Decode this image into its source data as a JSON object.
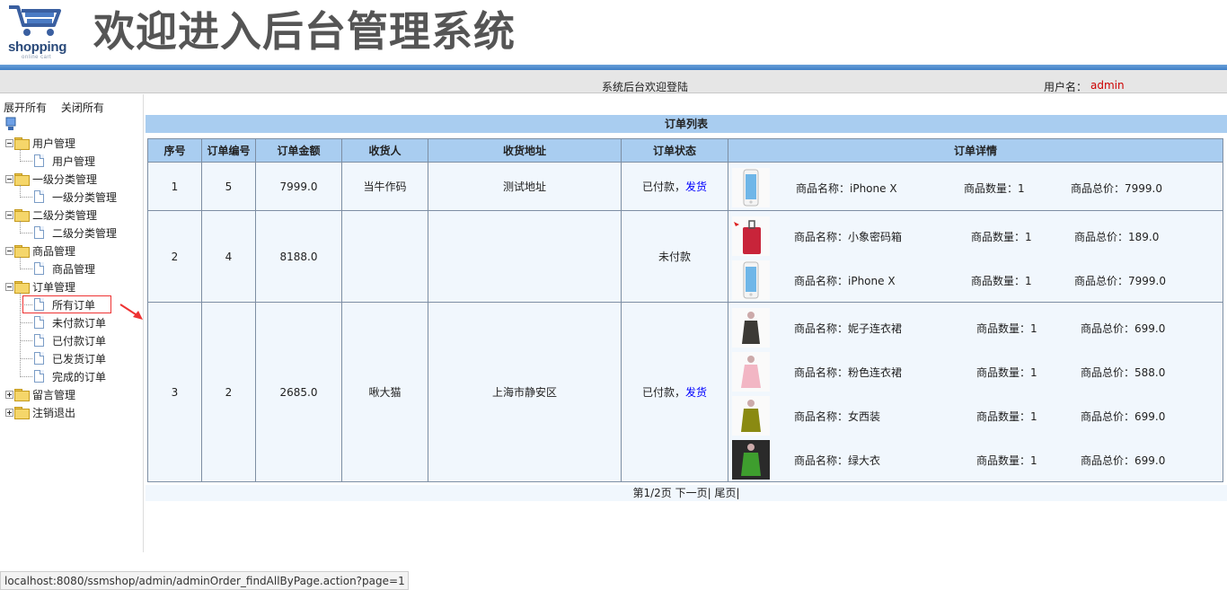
{
  "header": {
    "logo_text": "shopping",
    "logo_subtext": "online cart",
    "title": "欢迎进入后台管理系统",
    "welcome_text": "系统后台欢迎登陆",
    "user_label": "用户名：",
    "user_name": "admin"
  },
  "sidebar": {
    "expand_all": "展开所有",
    "collapse_all": "关闭所有",
    "groups": [
      {
        "label": "用户管理",
        "children": [
          "用户管理"
        ]
      },
      {
        "label": "一级分类管理",
        "children": [
          "一级分类管理"
        ]
      },
      {
        "label": "二级分类管理",
        "children": [
          "二级分类管理"
        ]
      },
      {
        "label": "商品管理",
        "children": [
          "商品管理"
        ]
      },
      {
        "label": "订单管理",
        "children": [
          "所有订单",
          "未付款订单",
          "已付款订单",
          "已发货订单",
          "完成的订单"
        ]
      },
      {
        "label": "留言管理",
        "children": []
      },
      {
        "label": "注销退出",
        "children": []
      }
    ],
    "selected": "所有订单"
  },
  "main": {
    "list_title": "订单列表",
    "columns": [
      "序号",
      "订单编号",
      "订单金额",
      "收货人",
      "收货地址",
      "订单状态",
      "订单详情"
    ],
    "orders": [
      {
        "index": "1",
        "order_no": "5",
        "amount": "7999.0",
        "receiver": "当牛作码",
        "address": "测试地址",
        "status": "已付款，",
        "action": "发货",
        "items": [
          {
            "name": "商品名称：iPhone X",
            "qty": "商品数量：1",
            "total": "商品总价：7999.0",
            "thumb": "phone"
          }
        ]
      },
      {
        "index": "2",
        "order_no": "4",
        "amount": "8188.0",
        "receiver": "",
        "address": "",
        "status": "未付款",
        "action": "",
        "items": [
          {
            "name": "商品名称：小象密码箱",
            "qty": "商品数量：1",
            "total": "商品总价：189.0",
            "thumb": "luggage"
          },
          {
            "name": "商品名称：iPhone X",
            "qty": "商品数量：1",
            "total": "商品总价：7999.0",
            "thumb": "phone"
          }
        ]
      },
      {
        "index": "3",
        "order_no": "2",
        "amount": "2685.0",
        "receiver": "啾大猫",
        "address": "上海市静安区",
        "status": "已付款，",
        "action": "发货",
        "items": [
          {
            "name": "商品名称：妮子连衣裙",
            "qty": "商品数量：1",
            "total": "商品总价：699.0",
            "thumb": "dress-dark"
          },
          {
            "name": "商品名称：粉色连衣裙",
            "qty": "商品数量：1",
            "total": "商品总价：588.0",
            "thumb": "dress-pink"
          },
          {
            "name": "商品名称：女西装",
            "qty": "商品数量：1",
            "total": "商品总价：699.0",
            "thumb": "coat-olive"
          },
          {
            "name": "商品名称：绿大衣",
            "qty": "商品数量：1",
            "total": "商品总价：699.0",
            "thumb": "coat-green"
          }
        ]
      }
    ],
    "pagination": {
      "page_info": "第1/2页",
      "next": "下一页",
      "last": "尾页",
      "sep": "|"
    }
  },
  "status_url": "localhost:8080/ssmshop/admin/adminOrder_findAllByPage.action?page=1",
  "colors": {
    "accent_blue": "#3e7fc6",
    "header_blue": "#a9cdf0",
    "link": "#0000ff",
    "user": "#cc0000"
  }
}
